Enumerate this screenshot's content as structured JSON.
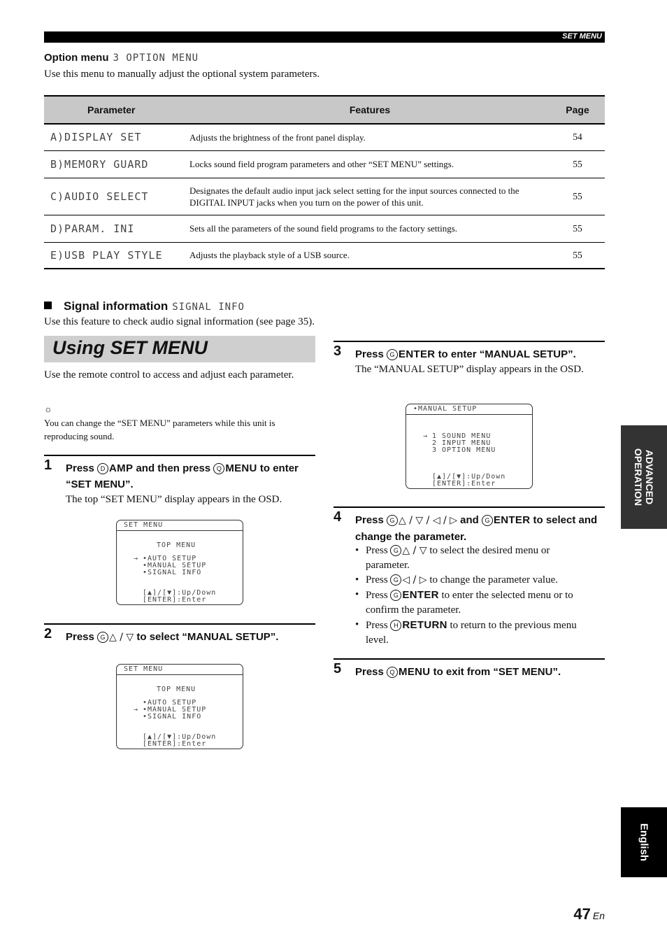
{
  "header": {
    "section": "SET MENU"
  },
  "option_menu": {
    "title": "Option menu",
    "lcd_label": "3 OPTION MENU",
    "description": "Use this menu to manually adjust the optional system parameters.",
    "table": {
      "headers": [
        "Parameter",
        "Features",
        "Page"
      ],
      "rows": [
        {
          "parameter": "A)DISPLAY SET",
          "features": "Adjusts the brightness of the front panel display.",
          "page": "54"
        },
        {
          "parameter": "B)MEMORY GUARD",
          "features": "Locks sound field program parameters and other “SET MENU” settings.",
          "page": "55"
        },
        {
          "parameter": "C)AUDIO SELECT",
          "features": "Designates the default audio input jack select setting for the input sources connected to the DIGITAL INPUT jacks when you turn on the power of this unit.",
          "page": "55"
        },
        {
          "parameter": "D)PARAM. INI",
          "features": "Sets all the parameters of the sound field programs to the factory settings.",
          "page": "55"
        },
        {
          "parameter": "E)USB PLAY STYLE",
          "features": "Adjusts the playback style of a USB source.",
          "page": "55"
        }
      ]
    }
  },
  "signal_info": {
    "title": "Signal information",
    "lcd_label": "SIGNAL INFO",
    "description": "Use this feature to check audio signal information (see page 35)."
  },
  "using": {
    "title": "Using SET MENU",
    "intro": "Use the remote control to access and adjust each parameter.",
    "tip": "You can change the “SET MENU” parameters while this unit is reproducing sound."
  },
  "steps": [
    {
      "num": "1",
      "press": "Press",
      "k1_circle": "D",
      "k1": "AMP",
      "mid": "and then press",
      "k2_circle": "Q",
      "k2": "MENU",
      "tail": "to enter “SET MENU”.",
      "body": "The top “SET MENU” display appears in the OSD."
    },
    {
      "num": "2",
      "press": "Press",
      "circle": "G",
      "arrows": "△ / ▽",
      "tail": "to select “MANUAL SETUP”."
    },
    {
      "num": "3",
      "press": "Press",
      "circle": "G",
      "key": "ENTER",
      "tail": "to enter “MANUAL SETUP”.",
      "body": "The “MANUAL SETUP” display appears in the OSD."
    },
    {
      "num": "4",
      "press": "Press",
      "circle": "G",
      "arrows": "△ / ▽ / ◁ / ▷",
      "mid": "and",
      "circle2": "G",
      "key": "ENTER",
      "tail": "to select and change the parameter.",
      "bullets": [
        {
          "pre": "Press",
          "circle": "G",
          "sym": "△ / ▽",
          "text": "to select the desired menu or parameter."
        },
        {
          "pre": "Press",
          "circle": "G",
          "sym": "◁ / ▷",
          "text": "to change the parameter value."
        },
        {
          "pre": "Press",
          "circle": "G",
          "key": "ENTER",
          "text": "to enter the selected menu or to confirm the parameter."
        },
        {
          "pre": "Press",
          "circle": "H",
          "key": "RETURN",
          "text": "to return to the previous menu level."
        }
      ]
    },
    {
      "num": "5",
      "press": "Press",
      "circle": "Q",
      "key": "MENU",
      "tail": "to exit from “SET MENU”."
    }
  ],
  "osd": [
    {
      "title": "SET MENU",
      "heading": "TOP MENU",
      "items": [
        "•AUTO SETUP",
        "•MANUAL SETUP",
        "•SIGNAL INFO"
      ],
      "cursor": "→",
      "selected_index": 0,
      "footer1": "[▲]/[▼]:Up/Down",
      "footer2": "[ENTER]:Enter"
    },
    {
      "title": "SET MENU",
      "heading": "TOP MENU",
      "items": [
        "•AUTO SETUP",
        "•MANUAL SETUP",
        "•SIGNAL INFO"
      ],
      "cursor": "→",
      "selected_index": 1,
      "footer1": "[▲]/[▼]:Up/Down",
      "footer2": "[ENTER]:Enter"
    },
    {
      "title": "•MANUAL SETUP",
      "heading": "",
      "items": [
        "1 SOUND MENU",
        "2 INPUT MENU",
        "3 OPTION MENU"
      ],
      "cursor": "→",
      "selected_index": 0,
      "footer1": "[▲]/[▼]:Up/Down",
      "footer2": "[ENTER]:Enter"
    }
  ],
  "side_tabs": {
    "section": "ADVANCED OPERATION",
    "section_line1": "ADVANCED",
    "section_line2": "OPERATION",
    "language": "English"
  },
  "footer": {
    "page_number": "47",
    "lang_suffix": "En"
  },
  "icons": {
    "tip": "☼"
  }
}
